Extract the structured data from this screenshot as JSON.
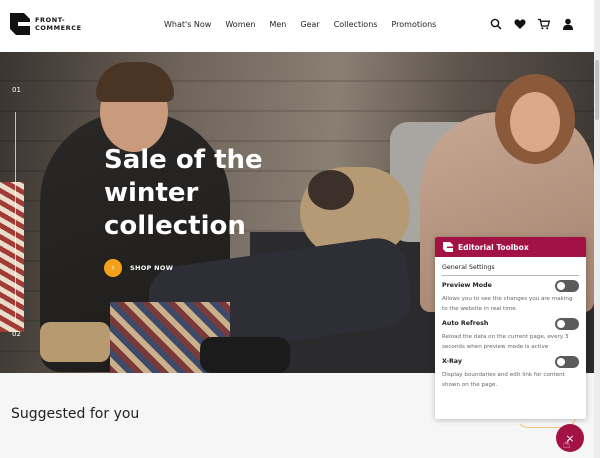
{
  "brand": {
    "name_line1": "FRONT-",
    "name_line2": "COMMERCE"
  },
  "nav": {
    "items": [
      "What's Now",
      "Women",
      "Men",
      "Gear",
      "Collections",
      "Promotions"
    ]
  },
  "header_icons": [
    "search-icon",
    "heart-icon",
    "cart-icon",
    "user-icon"
  ],
  "hero": {
    "pager_top": "01",
    "pager_bottom": "02",
    "title": "Sale of the winter collection",
    "cta_label": "SHOP NOW",
    "cta_color": "#f4a21c"
  },
  "suggested": {
    "title": "Suggested for you"
  },
  "toolbox": {
    "title": "Editorial Toolbox",
    "accent": "#a31245",
    "section": "General Settings",
    "items": [
      {
        "name": "Preview Mode",
        "description": "Allows you to see the changes you are making to the website in real time."
      },
      {
        "name": "Auto Refresh",
        "description": "Reload the data on the current page, every 3 seconds when preview mode is active"
      },
      {
        "name": "X-Ray",
        "description": "Display boundaries and edit link for content shown on the page."
      }
    ]
  },
  "fab": {
    "icon": "close-icon",
    "label": "×"
  }
}
